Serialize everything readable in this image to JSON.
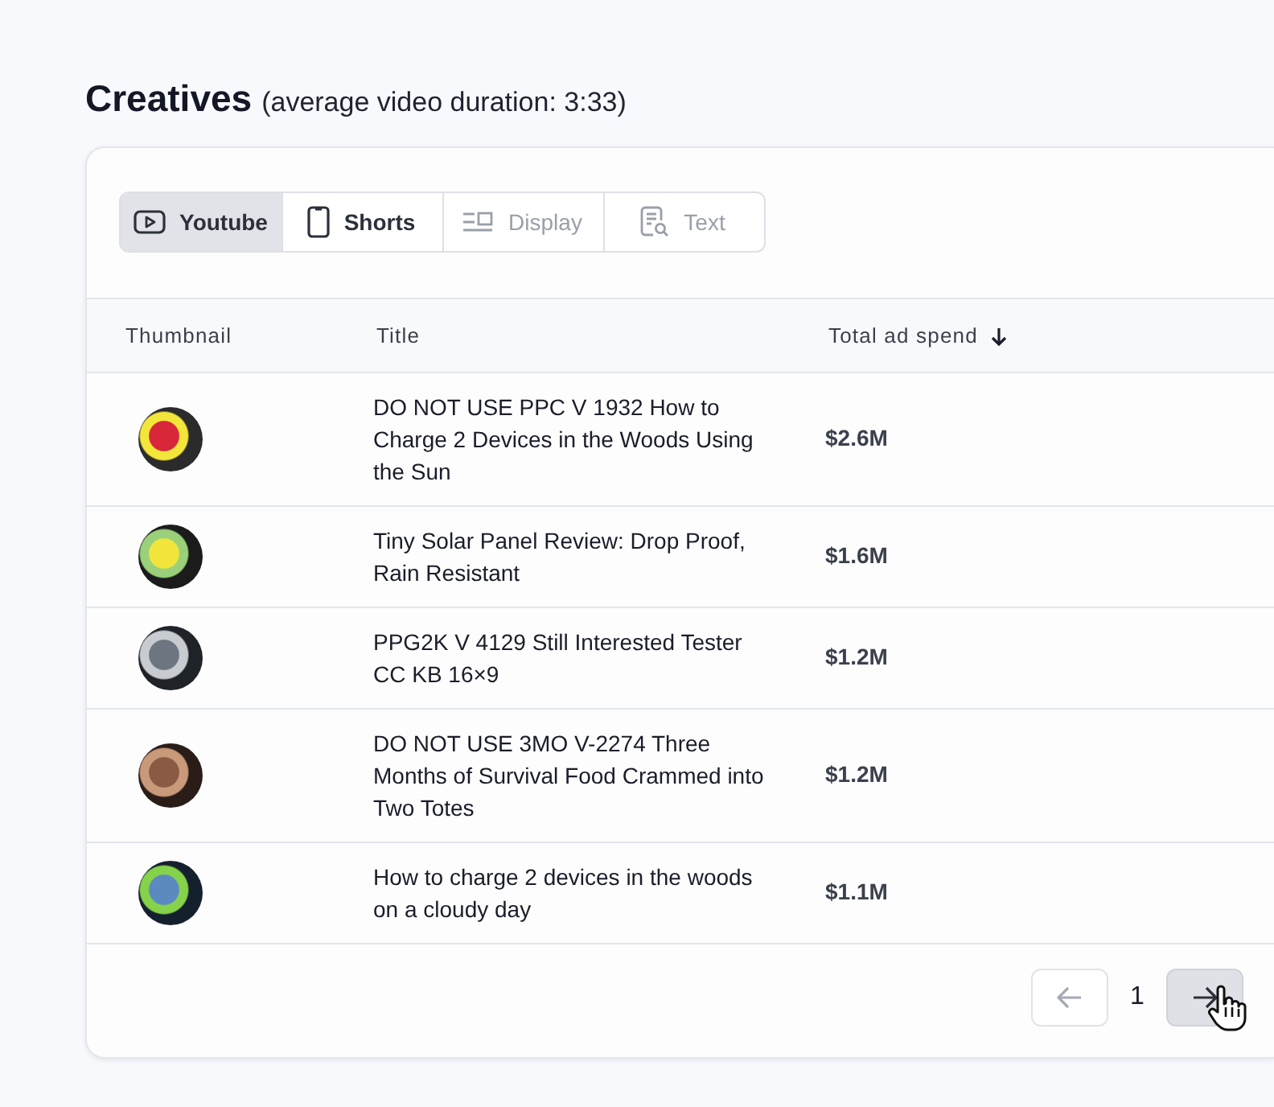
{
  "heading": {
    "title": "Creatives",
    "subtitle": "(average video duration: 3:33)"
  },
  "tabs": [
    {
      "label": "Youtube",
      "kind": "video",
      "selected": true,
      "disabled": false
    },
    {
      "label": "Shorts",
      "kind": "vertical",
      "selected": false,
      "disabled": false
    },
    {
      "label": "Display",
      "kind": "display",
      "selected": false,
      "disabled": true
    },
    {
      "label": "Text",
      "kind": "text",
      "selected": false,
      "disabled": true
    }
  ],
  "table": {
    "columns": [
      {
        "label": "Thumbnail"
      },
      {
        "label": "Title"
      },
      {
        "label": "Total ad spend",
        "sorted": true
      }
    ],
    "rows": [
      {
        "title": "DO NOT USE PPC V 1932 How to Charge 2 Devices in the Woods Using the Sun",
        "spend": "$2.6M"
      },
      {
        "title": "Tiny Solar Panel Review: Drop Proof, Rain Resistant",
        "spend": "$1.6M"
      },
      {
        "title": "PPG2K V 4129 Still Interested Tester CC KB 16×9",
        "spend": "$1.2M"
      },
      {
        "title": "DO NOT USE 3MO V-2274 Three Months of Survival Food Crammed into Two Totes",
        "spend": "$1.2M"
      },
      {
        "title": "How to charge 2 devices in the woods on a cloudy day",
        "spend": "$1.1M"
      }
    ]
  },
  "pagination": {
    "page": "1",
    "prev": {
      "disabled": true,
      "hovered": false
    },
    "next": {
      "disabled": false,
      "hovered": true
    }
  }
}
